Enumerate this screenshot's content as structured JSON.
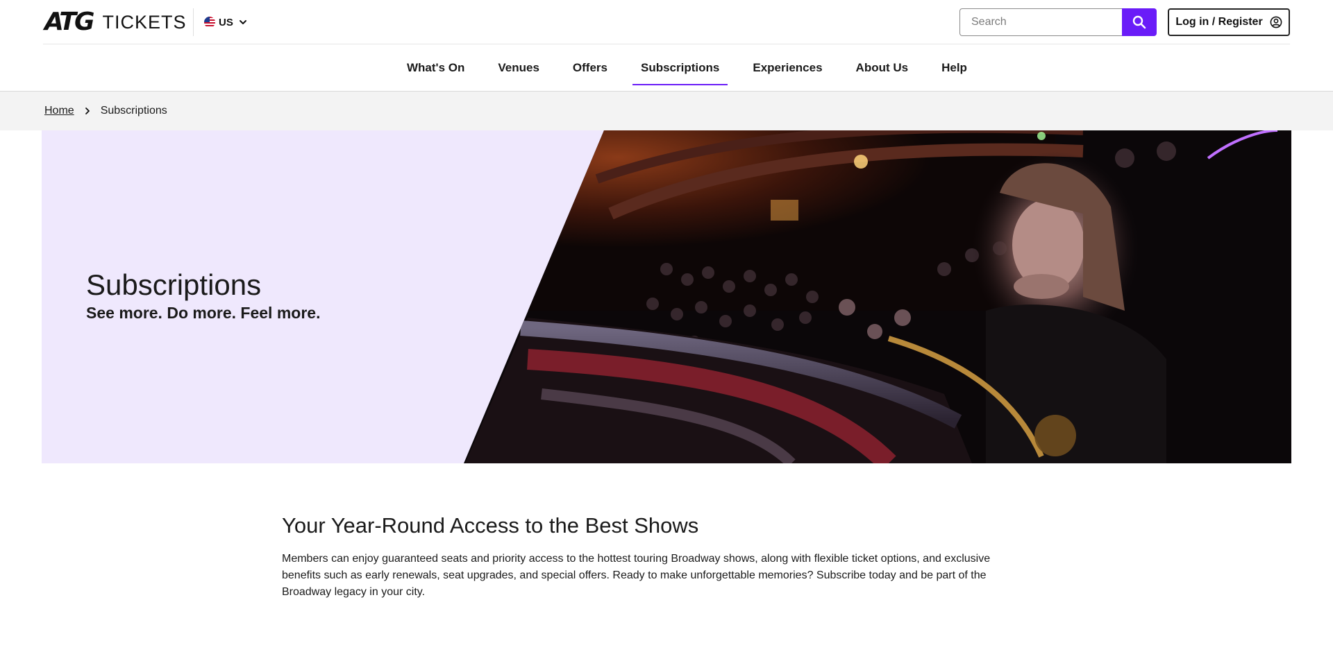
{
  "header": {
    "logo_mark": "ATG",
    "logo_word": "TICKETS",
    "locale": "US",
    "search_placeholder": "Search",
    "login_label": "Log in / Register"
  },
  "nav": {
    "items": [
      {
        "label": "What's On"
      },
      {
        "label": "Venues"
      },
      {
        "label": "Offers"
      },
      {
        "label": "Subscriptions",
        "active": true
      },
      {
        "label": "Experiences"
      },
      {
        "label": "About Us"
      },
      {
        "label": "Help"
      }
    ]
  },
  "breadcrumb": {
    "home": "Home",
    "current": "Subscriptions"
  },
  "hero": {
    "title": "Subscriptions",
    "subtitle": "See more. Do more. Feel more."
  },
  "intro": {
    "heading": "Your Year-Round Access to the Best Shows",
    "body": "Members can enjoy guaranteed seats and priority access to the hottest touring Broadway shows, along with flexible ticket options, and exclusive benefits such as early renewals, seat upgrades, and special offers. Ready to make unforgettable memories? Subscribe today and be part of the Broadway legacy in your city."
  },
  "colors": {
    "accent": "#6a1cf8",
    "hero_background": "#efe8fd",
    "breadcrumb_background": "#f3f3f3"
  }
}
